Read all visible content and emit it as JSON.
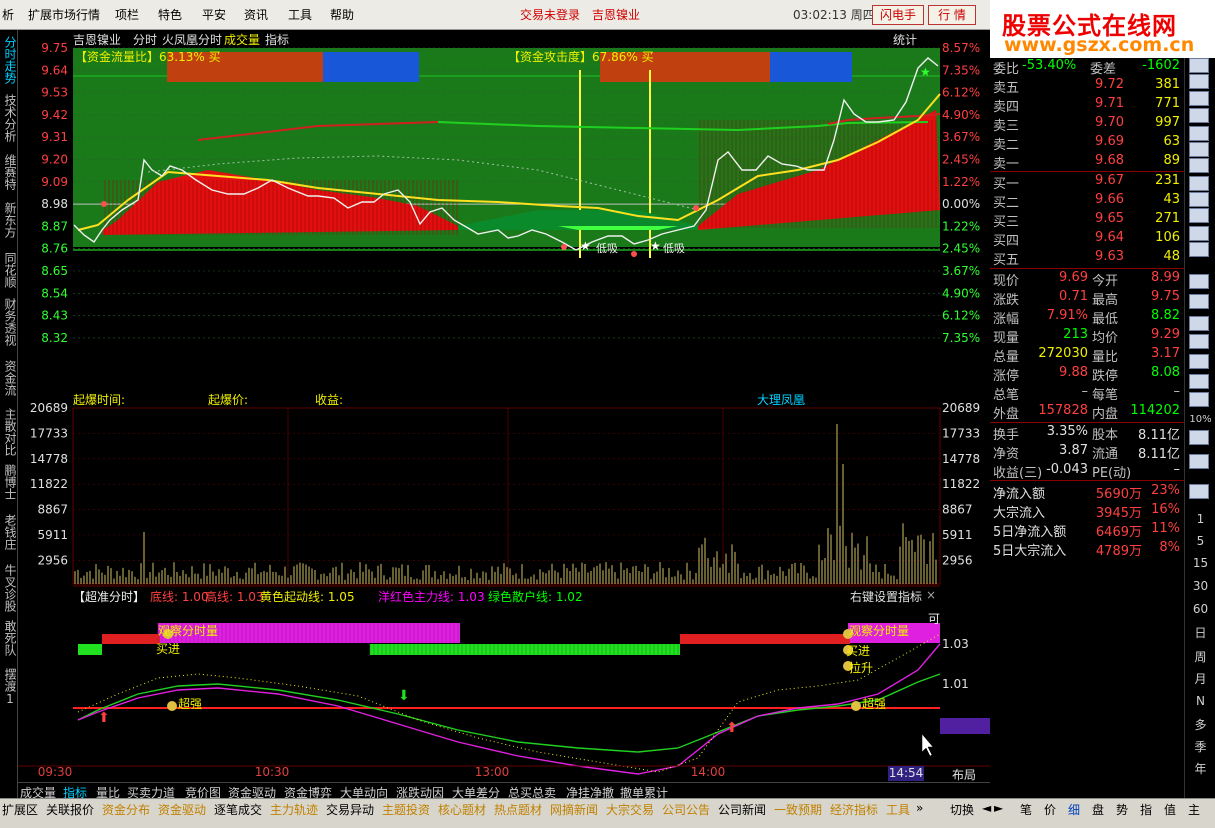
{
  "menu": {
    "items": [
      "析",
      "扩展市场行情",
      "项栏",
      "特色",
      "平安",
      "资讯",
      "工具",
      "帮助"
    ],
    "login_status": "交易未登录",
    "account_name": "吉恩镍业",
    "clock": "03:02:13 周四",
    "btn_flash": "闪电手",
    "btn_quote": "行 情"
  },
  "logo": {
    "line1": "股票公式在线网",
    "line2": "www.gszx.com.cn"
  },
  "leftbar": [
    "分时走势",
    "技术分析",
    "维赛特",
    "新东方",
    "同花顺",
    "财务透视",
    "资金流",
    "主散对比",
    "鹏博士",
    "老钱庄",
    "牛叉诊股",
    "敢死队",
    "摆渡1"
  ],
  "chart_header": {
    "stock": "吉恩镍业",
    "mode": "分时",
    "indicator1": "火凤凰分时",
    "indicator2": "成交量",
    "indicator3": "指标",
    "stats": "统计"
  },
  "price_panel": {
    "money_flow_ratio": "【资金流量比】63.13% 买",
    "money_attack": "【资金攻击度】67.86% 买",
    "left_axis": [
      "9.75",
      "9.64",
      "9.53",
      "9.42",
      "9.31",
      "9.20",
      "9.09",
      "8.98",
      "8.87",
      "8.76",
      "8.65",
      "8.54",
      "8.43",
      "8.32"
    ],
    "right_axis": [
      "8.57%",
      "7.35%",
      "6.12%",
      "4.90%",
      "3.67%",
      "2.45%",
      "1.22%",
      "0.00%",
      "1.22%",
      "2.45%",
      "3.67%",
      "4.90%",
      "6.12%",
      "7.35%"
    ],
    "signal_low_absorb": "低吸",
    "footer_time": "起爆时间:",
    "footer_price": "起爆价:",
    "footer_profit": "收益:",
    "footer_name": "大理凤凰"
  },
  "volume_panel": {
    "axis": [
      "20689",
      "17733",
      "14778",
      "11822",
      "8867",
      "5911",
      "2956"
    ]
  },
  "indicator_panel": {
    "title": "【超准分时】",
    "params": [
      {
        "label": "底线: 1.00",
        "color": "#ff4040"
      },
      {
        "label": "高线: 1.03",
        "color": "#ff4040"
      },
      {
        "label": "黄色起动线: 1.05",
        "color": "#f0f000"
      },
      {
        "label": "洋红色主力线: 1.03",
        "color": "#ff00ff"
      },
      {
        "label": "绿色散户线: 1.02",
        "color": "#00ff00"
      }
    ],
    "settings": "右键设置指标",
    "axis": [
      "1.03",
      "1.01",
      "0.99"
    ],
    "watch_volume": "观察分时量",
    "buy_in": "买进",
    "super_strong": "超强",
    "pull_up": "拉升",
    "top_right_text": "可"
  },
  "time_axis": [
    "09:30",
    "10:30",
    "13:00",
    "14:00"
  ],
  "cursor_time": "14:54",
  "layout_label": "布局",
  "orderbook": {
    "ratio_label": "委比",
    "ratio_value": "-53.40%",
    "diff_label": "委差",
    "diff_value": "-1602",
    "asks": [
      {
        "label": "卖五",
        "price": "9.72",
        "vol": "381"
      },
      {
        "label": "卖四",
        "price": "9.71",
        "vol": "771"
      },
      {
        "label": "卖三",
        "price": "9.70",
        "vol": "997"
      },
      {
        "label": "卖二",
        "price": "9.69",
        "vol": "63"
      },
      {
        "label": "卖一",
        "price": "9.68",
        "vol": "89"
      }
    ],
    "bids": [
      {
        "label": "买一",
        "price": "9.67",
        "vol": "231"
      },
      {
        "label": "买二",
        "price": "9.66",
        "vol": "43"
      },
      {
        "label": "买三",
        "price": "9.65",
        "vol": "271"
      },
      {
        "label": "买四",
        "price": "9.64",
        "vol": "106"
      },
      {
        "label": "买五",
        "price": "9.63",
        "vol": "48"
      }
    ]
  },
  "quote": [
    {
      "k1": "现价",
      "v1": "9.69",
      "c1": "#ff4040",
      "k2": "今开",
      "v2": "8.99",
      "c2": "#ff4040"
    },
    {
      "k1": "涨跌",
      "v1": "0.71",
      "c1": "#ff4040",
      "k2": "最高",
      "v2": "9.75",
      "c2": "#ff4040"
    },
    {
      "k1": "涨幅",
      "v1": "7.91%",
      "c1": "#ff4040",
      "k2": "最低",
      "v2": "8.82",
      "c2": "#00ff00"
    },
    {
      "k1": "现量",
      "v1": "213",
      "c1": "#00ff00",
      "k2": "均价",
      "v2": "9.29",
      "c2": "#ff4040"
    },
    {
      "k1": "总量",
      "v1": "272030",
      "c1": "#f0f000",
      "k2": "量比",
      "v2": "3.17",
      "c2": "#ff4040"
    },
    {
      "k1": "涨停",
      "v1": "9.88",
      "c1": "#ff4040",
      "k2": "跌停",
      "v2": "8.08",
      "c2": "#00ff00"
    },
    {
      "k1": "总笔",
      "v1": "–",
      "c1": "#c0c0c0",
      "k2": "每笔",
      "v2": "–",
      "c2": "#c0c0c0"
    },
    {
      "k1": "外盘",
      "v1": "157828",
      "c1": "#ff4040",
      "k2": "内盘",
      "v2": "114202",
      "c2": "#00ff00"
    }
  ],
  "fundamentals": [
    {
      "k1": "换手",
      "v1": "3.35%",
      "k2": "股本",
      "v2": "8.11亿"
    },
    {
      "k1": "净资",
      "v1": "3.87",
      "k2": "流通",
      "v2": "8.11亿"
    },
    {
      "k1": "收益(三)",
      "v1": "-0.043",
      "k2": "PE(动)",
      "v2": "–"
    }
  ],
  "flows": [
    {
      "label": "净流入额",
      "value": "5690万",
      "pct": "23%"
    },
    {
      "label": "大宗流入",
      "value": "3945万",
      "pct": "16%"
    },
    {
      "label": "5日净流入额",
      "value": "6469万",
      "pct": "11%"
    },
    {
      "label": "5日大宗流入",
      "value": "4789万",
      "pct": "8%"
    }
  ],
  "icon_text": [
    "1",
    "5",
    "15",
    "30",
    "60",
    "日",
    "周",
    "月",
    "N",
    "多",
    "季",
    "年"
  ],
  "icon_pct": "10%",
  "sub_tabs": [
    "成交量",
    "指标",
    "量比",
    "买卖力道",
    "竞价图",
    "资金驱动",
    "资金博弈",
    "大单动向",
    "涨跌动因",
    "大单差分",
    "总买总卖",
    "净挂净撤",
    "撤单累计"
  ],
  "bottom_tabs": [
    {
      "label": "扩展区",
      "color": "#000"
    },
    {
      "label": "关联报价",
      "color": "#000"
    },
    {
      "label": "资金分布",
      "color": "#c08000"
    },
    {
      "label": "资金驱动",
      "color": "#c08000"
    },
    {
      "label": "逐笔成交",
      "color": "#000"
    },
    {
      "label": "主力轨迹",
      "color": "#c08000"
    },
    {
      "label": "交易异动",
      "color": "#000"
    },
    {
      "label": "主题投资",
      "color": "#c08000"
    },
    {
      "label": "核心题材",
      "color": "#c08000"
    },
    {
      "label": "热点题材",
      "color": "#c08000"
    },
    {
      "label": "网摘新闻",
      "color": "#c08000"
    },
    {
      "label": "大宗交易",
      "color": "#c08000"
    },
    {
      "label": "公司公告",
      "color": "#c08000"
    },
    {
      "label": "公司新闻",
      "color": "#000"
    },
    {
      "label": "一致预期",
      "color": "#c08000"
    },
    {
      "label": "经济指标",
      "color": "#c08000"
    },
    {
      "label": "工具",
      "color": "#c08000"
    },
    {
      "label": "切换",
      "color": "#000"
    }
  ],
  "right_tabs": [
    "笔",
    "价",
    "细",
    "盘",
    "势",
    "指",
    "值",
    "主"
  ],
  "colors": {
    "up": "#ff4040",
    "down": "#00ff00",
    "accent_yellow": "#f0f000",
    "magenta": "#ff00ff",
    "cyan": "#00d0ff"
  }
}
